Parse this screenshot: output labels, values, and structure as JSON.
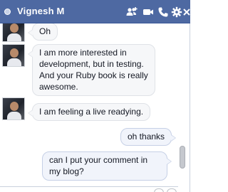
{
  "header": {
    "title": "Vignesh M",
    "icons": [
      "add-friend-icon",
      "video-call-icon",
      "phone-icon",
      "gear-icon",
      "close-icon"
    ],
    "colors": {
      "header_bg": "#4e69a2",
      "bubble_bg": "#f6f7f9",
      "bubble_out_bg": "#f1f4fb"
    }
  },
  "messages": [
    {
      "direction": "incoming",
      "text": "Oh"
    },
    {
      "direction": "incoming",
      "text": "I am more interested in development, but in testing. And your Ruby book is really awesome."
    },
    {
      "direction": "incoming",
      "text": "I am feeling a live readying."
    },
    {
      "direction": "outgoing",
      "text": "oh thanks"
    },
    {
      "direction": "outgoing",
      "text": "can I put your comment in my blog?"
    }
  ],
  "composer": {
    "value": "",
    "placeholder": "",
    "icons": [
      "sticker-icon",
      "emoji-icon"
    ]
  }
}
